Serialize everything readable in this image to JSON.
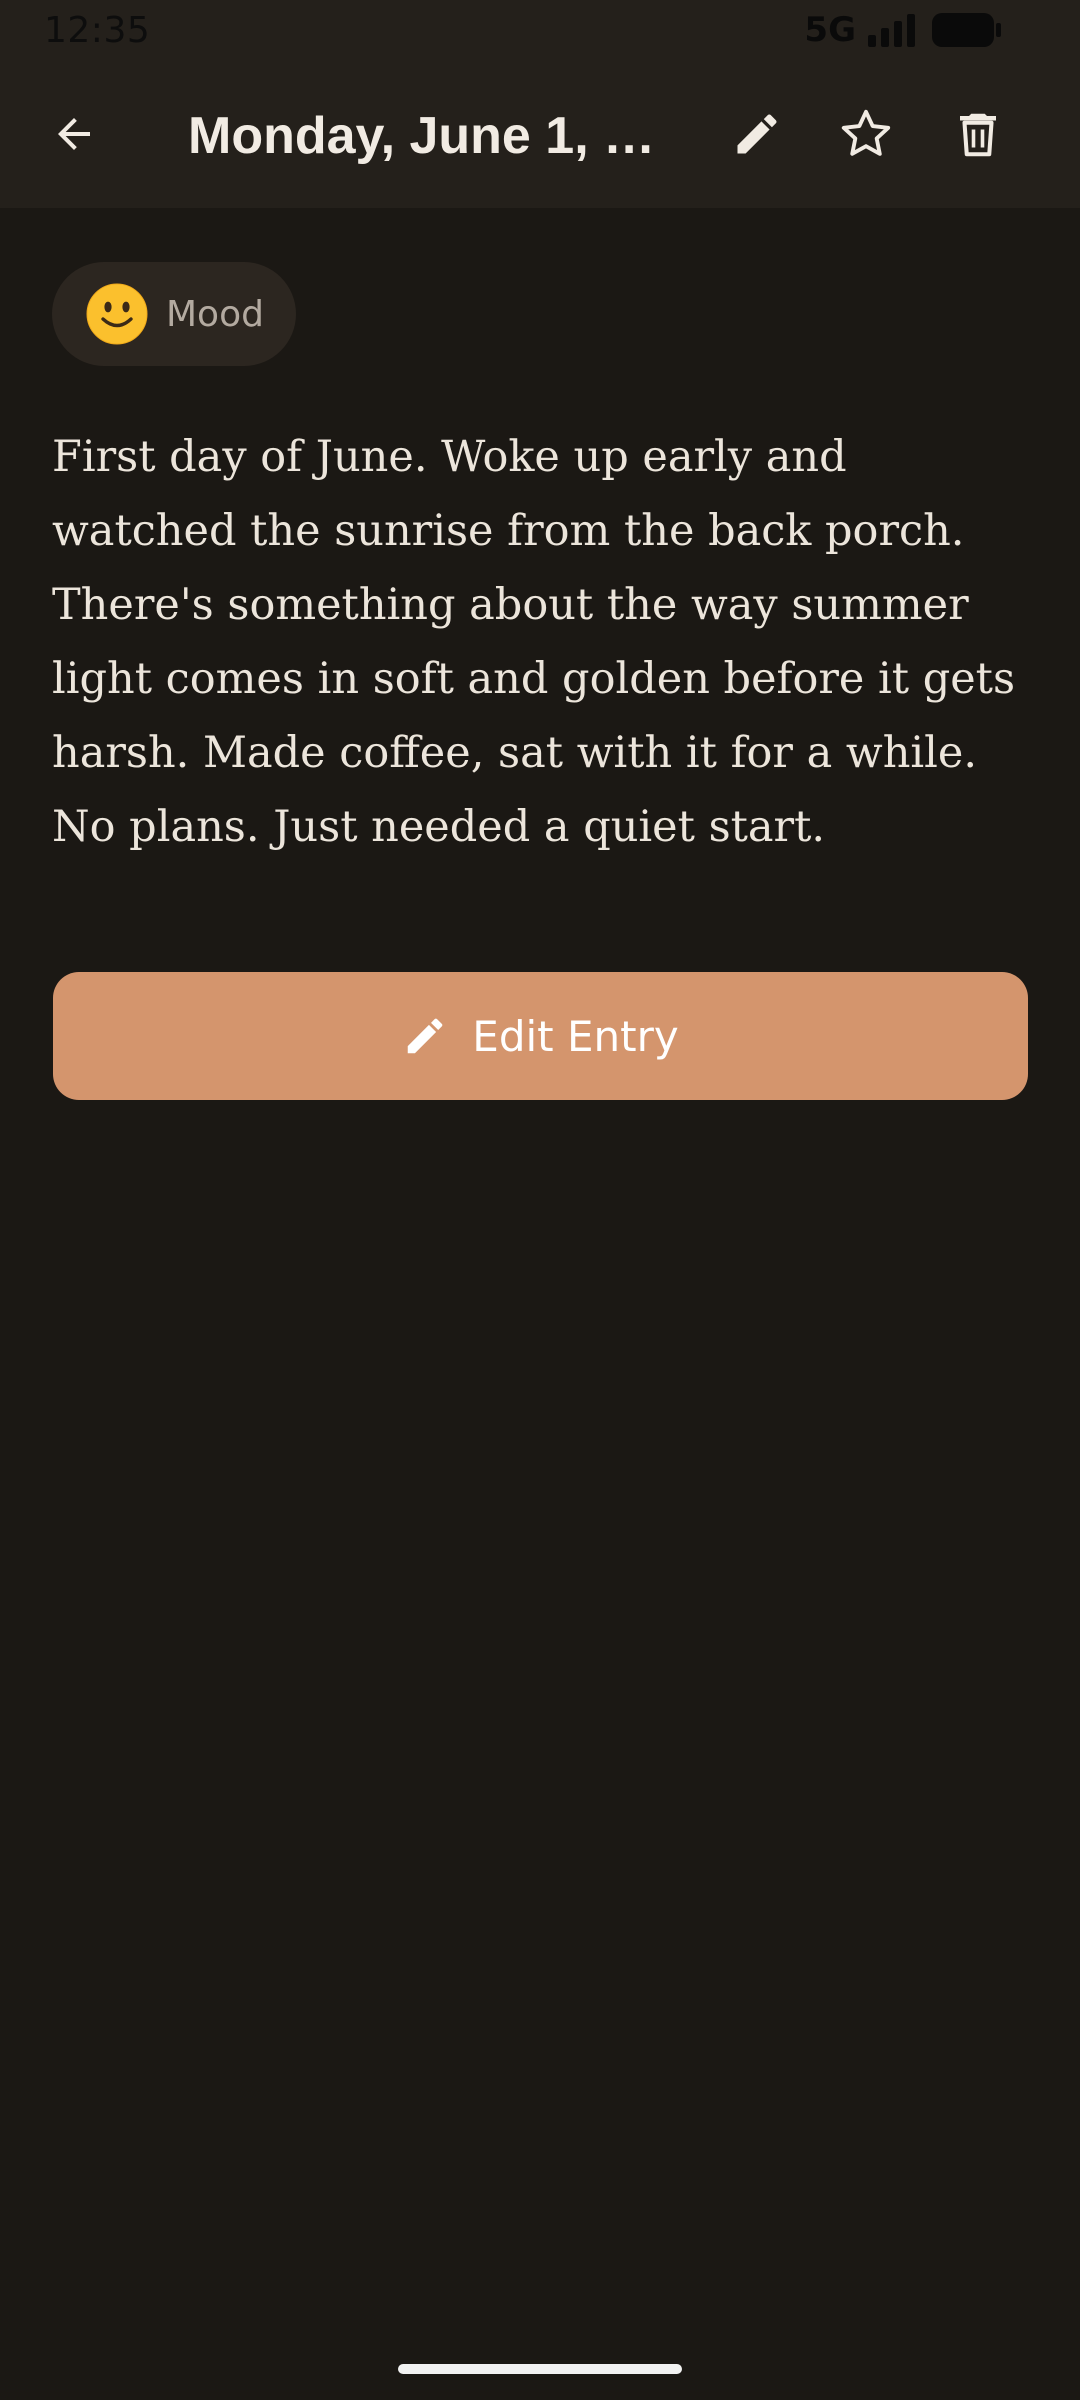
{
  "status_bar": {
    "time": "12:35",
    "network": "5G",
    "signal_icon": "signal-bars-icon",
    "battery_icon": "battery-icon"
  },
  "app_bar": {
    "title": "Monday, June 1, 2…",
    "back_icon": "arrow-back-icon",
    "edit_icon": "pencil-icon",
    "favorite_icon": "star-outline-icon",
    "delete_icon": "trash-icon"
  },
  "mood": {
    "emoji_icon": "slightly-smiling-face-icon",
    "label": "Mood"
  },
  "entry": {
    "text": "First day of June. Woke up early and watched the sunrise from the back porch. There's something about the way summer light comes in soft and golden before it gets harsh. Made coffee, sat with it for a while. No plans. Just needed a quiet start."
  },
  "edit_button": {
    "icon": "pencil-icon",
    "label": "Edit Entry"
  },
  "colors": {
    "background": "#1b1814",
    "app_bar": "#24201b",
    "chip": "#2c2620",
    "accent": "#d4956d",
    "text_primary": "#ece5db",
    "text_secondary": "#b3aaa0"
  }
}
